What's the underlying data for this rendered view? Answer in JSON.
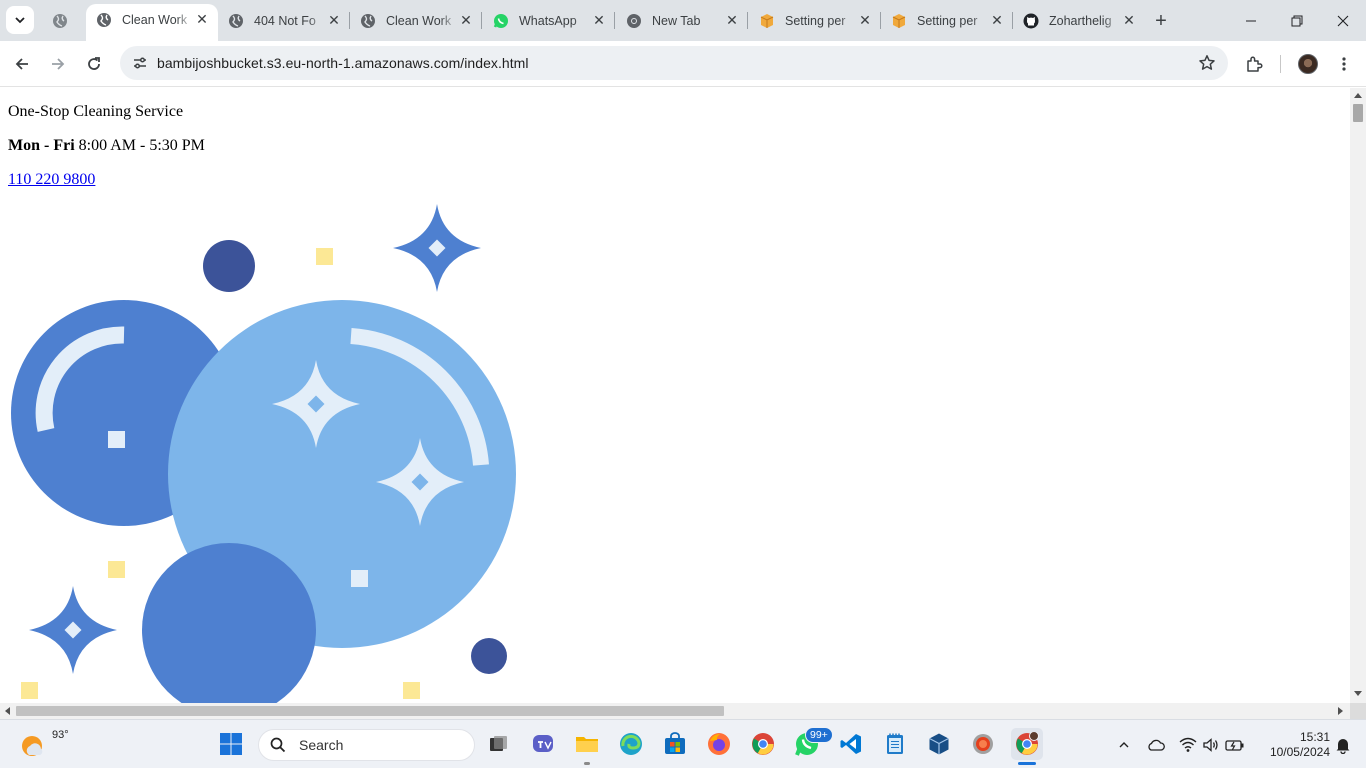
{
  "browser": {
    "tabs": [
      {
        "title": "",
        "pinned": true,
        "icon": "globe-icon"
      },
      {
        "title": "Clean Work",
        "active": true,
        "icon": "globe-icon"
      },
      {
        "title": "404 Not Fo",
        "icon": "globe-icon"
      },
      {
        "title": "Clean Work",
        "icon": "globe-icon"
      },
      {
        "title": "WhatsApp",
        "icon": "whatsapp-icon"
      },
      {
        "title": "New Tab",
        "icon": "chrome-icon"
      },
      {
        "title": "Setting per",
        "icon": "aws-icon"
      },
      {
        "title": "Setting per",
        "icon": "aws-icon"
      },
      {
        "title": "Zoharthelig",
        "icon": "github-icon"
      }
    ],
    "url": "bambijoshbucket.s3.eu-north-1.amazonaws.com/index.html"
  },
  "page": {
    "tagline": "One-Stop Cleaning Service",
    "hours_days": "Mon - Fri",
    "hours_time": " 8:00 AM - 5:30 PM",
    "phone": "110 220 9800"
  },
  "colors": {
    "bubble_dark": "#4e80d0",
    "bubble_light": "#7db5ea",
    "dot_navy": "#3c5399",
    "sparkle_light": "#e3eef9",
    "square_yellow": "#fce895"
  },
  "taskbar": {
    "temperature": "93°",
    "search_placeholder": "Search",
    "whatsapp_badge": "99+",
    "time": "15:31",
    "date": "10/05/2024"
  }
}
